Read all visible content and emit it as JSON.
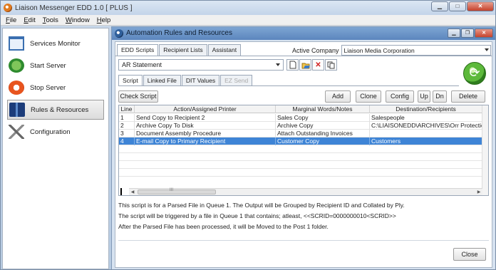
{
  "window": {
    "title": "Liaison Messenger EDD 1.0 [ PLUS ]"
  },
  "menu": [
    "File",
    "Edit",
    "Tools",
    "Window",
    "Help"
  ],
  "sidebar": {
    "items": [
      {
        "label": "Services Monitor",
        "icon": "monitor-icon"
      },
      {
        "label": "Start Server",
        "icon": "start-server-icon"
      },
      {
        "label": "Stop Server",
        "icon": "stop-server-icon"
      },
      {
        "label": "Rules & Resources",
        "icon": "rules-icon",
        "active": true
      },
      {
        "label": "Configuration",
        "icon": "configuration-icon"
      }
    ]
  },
  "child": {
    "title": "Automation Rules and Resources",
    "tabs": [
      "EDD Scripts",
      "Recipient Lists",
      "Assistant"
    ],
    "company_label": "Active Company",
    "company_value": "Liaison Media Corporation",
    "script_value": "AR Statement",
    "subtabs": [
      "Script",
      "Linked File",
      "DIT Values",
      "EZ Send"
    ],
    "buttons": {
      "check_script": "Check Script",
      "add": "Add",
      "clone": "Clone",
      "config": "Config",
      "up": "Up",
      "dn": "Dn",
      "delete": "Delete",
      "close": "Close"
    },
    "grid": {
      "headers": [
        "Line",
        "Action/Assigned Printer",
        "Marginal Words/Notes",
        "Destination/Recipients"
      ],
      "rows": [
        [
          "1",
          "Send Copy to Recipient 2",
          "Sales Copy",
          "Salespeople"
        ],
        [
          "2",
          "Archive Copy To Disk",
          "Archive Copy",
          "C:\\LIAISONEDD\\ARCHIVES\\Orr Protection"
        ],
        [
          "3",
          "Document Assembly Procedure",
          "Attach Outstanding Invoices",
          ""
        ],
        [
          "4",
          "E-mail Copy to Primary Recipient",
          "Customer Copy",
          "Customers"
        ]
      ],
      "selected_row": 3,
      "scroll_thumb": "III"
    },
    "description": [
      "This script is for a Parsed File in Queue 1. The Output will be Grouped by Recipient ID and Collated by Ply.",
      "The script will be triggered by a file in Queue 1 that contains; atleast, <<SCRID=0000000010<SCRID>>",
      "After the Parsed File has been processed, it will be Moved to the Post 1 folder."
    ]
  },
  "colors": {
    "selection": "#3e84d6",
    "accent": "#5b86bd"
  }
}
